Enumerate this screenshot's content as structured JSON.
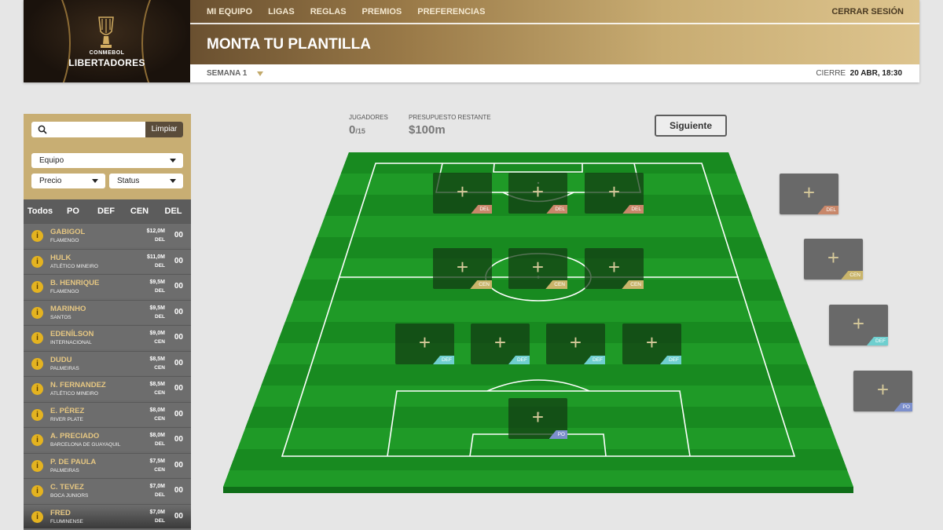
{
  "logo": {
    "small": "CONMEBOL",
    "big": "LIBERTADORES"
  },
  "nav": {
    "items": [
      "MI EQUIPO",
      "LIGAS",
      "REGLAS",
      "PREMIOS",
      "PREFERENCIAS"
    ],
    "logout": "CERRAR SESIÓN"
  },
  "page": {
    "title": "MONTA TU PLANTILLA"
  },
  "week": {
    "label": "SEMANA 1"
  },
  "deadline": {
    "label": "CIERRE",
    "value": "20 ABR, 18:30"
  },
  "sidebar": {
    "search_placeholder": "",
    "clear_label": "Limpiar",
    "team_filter": "Equipo",
    "price_filter": "Precio",
    "status_filter": "Status",
    "tabs": [
      "Todos",
      "PO",
      "DEF",
      "CEN",
      "DEL"
    ],
    "players": [
      {
        "name": "GABIGOL",
        "team": "FLAMENGO",
        "price": "$12,0M",
        "pos": "DEL",
        "points": "00"
      },
      {
        "name": "HULK",
        "team": "ATLÉTICO MINEIRO",
        "price": "$11,0M",
        "pos": "DEL",
        "points": "00"
      },
      {
        "name": "B. HENRIQUE",
        "team": "FLAMENGO",
        "price": "$9,5M",
        "pos": "DEL",
        "points": "00"
      },
      {
        "name": "MARINHO",
        "team": "SANTOS",
        "price": "$9,5M",
        "pos": "DEL",
        "points": "00"
      },
      {
        "name": "EDENÍLSON",
        "team": "INTERNACIONAL",
        "price": "$9,0M",
        "pos": "CEN",
        "points": "00"
      },
      {
        "name": "DUDU",
        "team": "PALMEIRAS",
        "price": "$8,5M",
        "pos": "CEN",
        "points": "00"
      },
      {
        "name": "N. FERNANDEZ",
        "team": "ATLÉTICO MINEIRO",
        "price": "$8,5M",
        "pos": "CEN",
        "points": "00"
      },
      {
        "name": "E. PÉREZ",
        "team": "RIVER PLATE",
        "price": "$8,0M",
        "pos": "CEN",
        "points": "00"
      },
      {
        "name": "A. PRECIADO",
        "team": "BARCELONA DE GUAYAQUIL",
        "price": "$8,0M",
        "pos": "DEL",
        "points": "00"
      },
      {
        "name": "P. DE PAULA",
        "team": "PALMEIRAS",
        "price": "$7,5M",
        "pos": "CEN",
        "points": "00"
      },
      {
        "name": "C. TEVEZ",
        "team": "BOCA JUNIORS",
        "price": "$7,0M",
        "pos": "DEL",
        "points": "00"
      },
      {
        "name": "FRED",
        "team": "FLUMINENSE",
        "price": "$7,0M",
        "pos": "DEL",
        "points": "00"
      }
    ]
  },
  "stats": {
    "players_label": "JUGADORES",
    "players_count": "0",
    "players_max": "/15",
    "budget_label": "PRESUPUESTO RESTANTE",
    "budget_value": "$100m"
  },
  "next_button": "Siguiente",
  "pitch": {
    "colors": {
      "grass": "#1f9a27",
      "grass_dark": "#188a20",
      "edge": "#0f6e18",
      "lines": "#ffffff"
    },
    "slots": [
      {
        "pos": "DEL",
        "plus": "+"
      },
      {
        "pos": "DEL",
        "plus": "+"
      },
      {
        "pos": "DEL",
        "plus": "+"
      },
      {
        "pos": "CEN",
        "plus": "+"
      },
      {
        "pos": "CEN",
        "plus": "+"
      },
      {
        "pos": "CEN",
        "plus": "+"
      },
      {
        "pos": "DEF",
        "plus": "+"
      },
      {
        "pos": "DEF",
        "plus": "+"
      },
      {
        "pos": "DEF",
        "plus": "+"
      },
      {
        "pos": "DEF",
        "plus": "+"
      },
      {
        "pos": "PO",
        "plus": "+"
      }
    ]
  },
  "bench": [
    {
      "pos": "DEL",
      "plus": "+"
    },
    {
      "pos": "CEN",
      "plus": "+"
    },
    {
      "pos": "DEF",
      "plus": "+"
    },
    {
      "pos": "PO",
      "plus": "+"
    }
  ]
}
